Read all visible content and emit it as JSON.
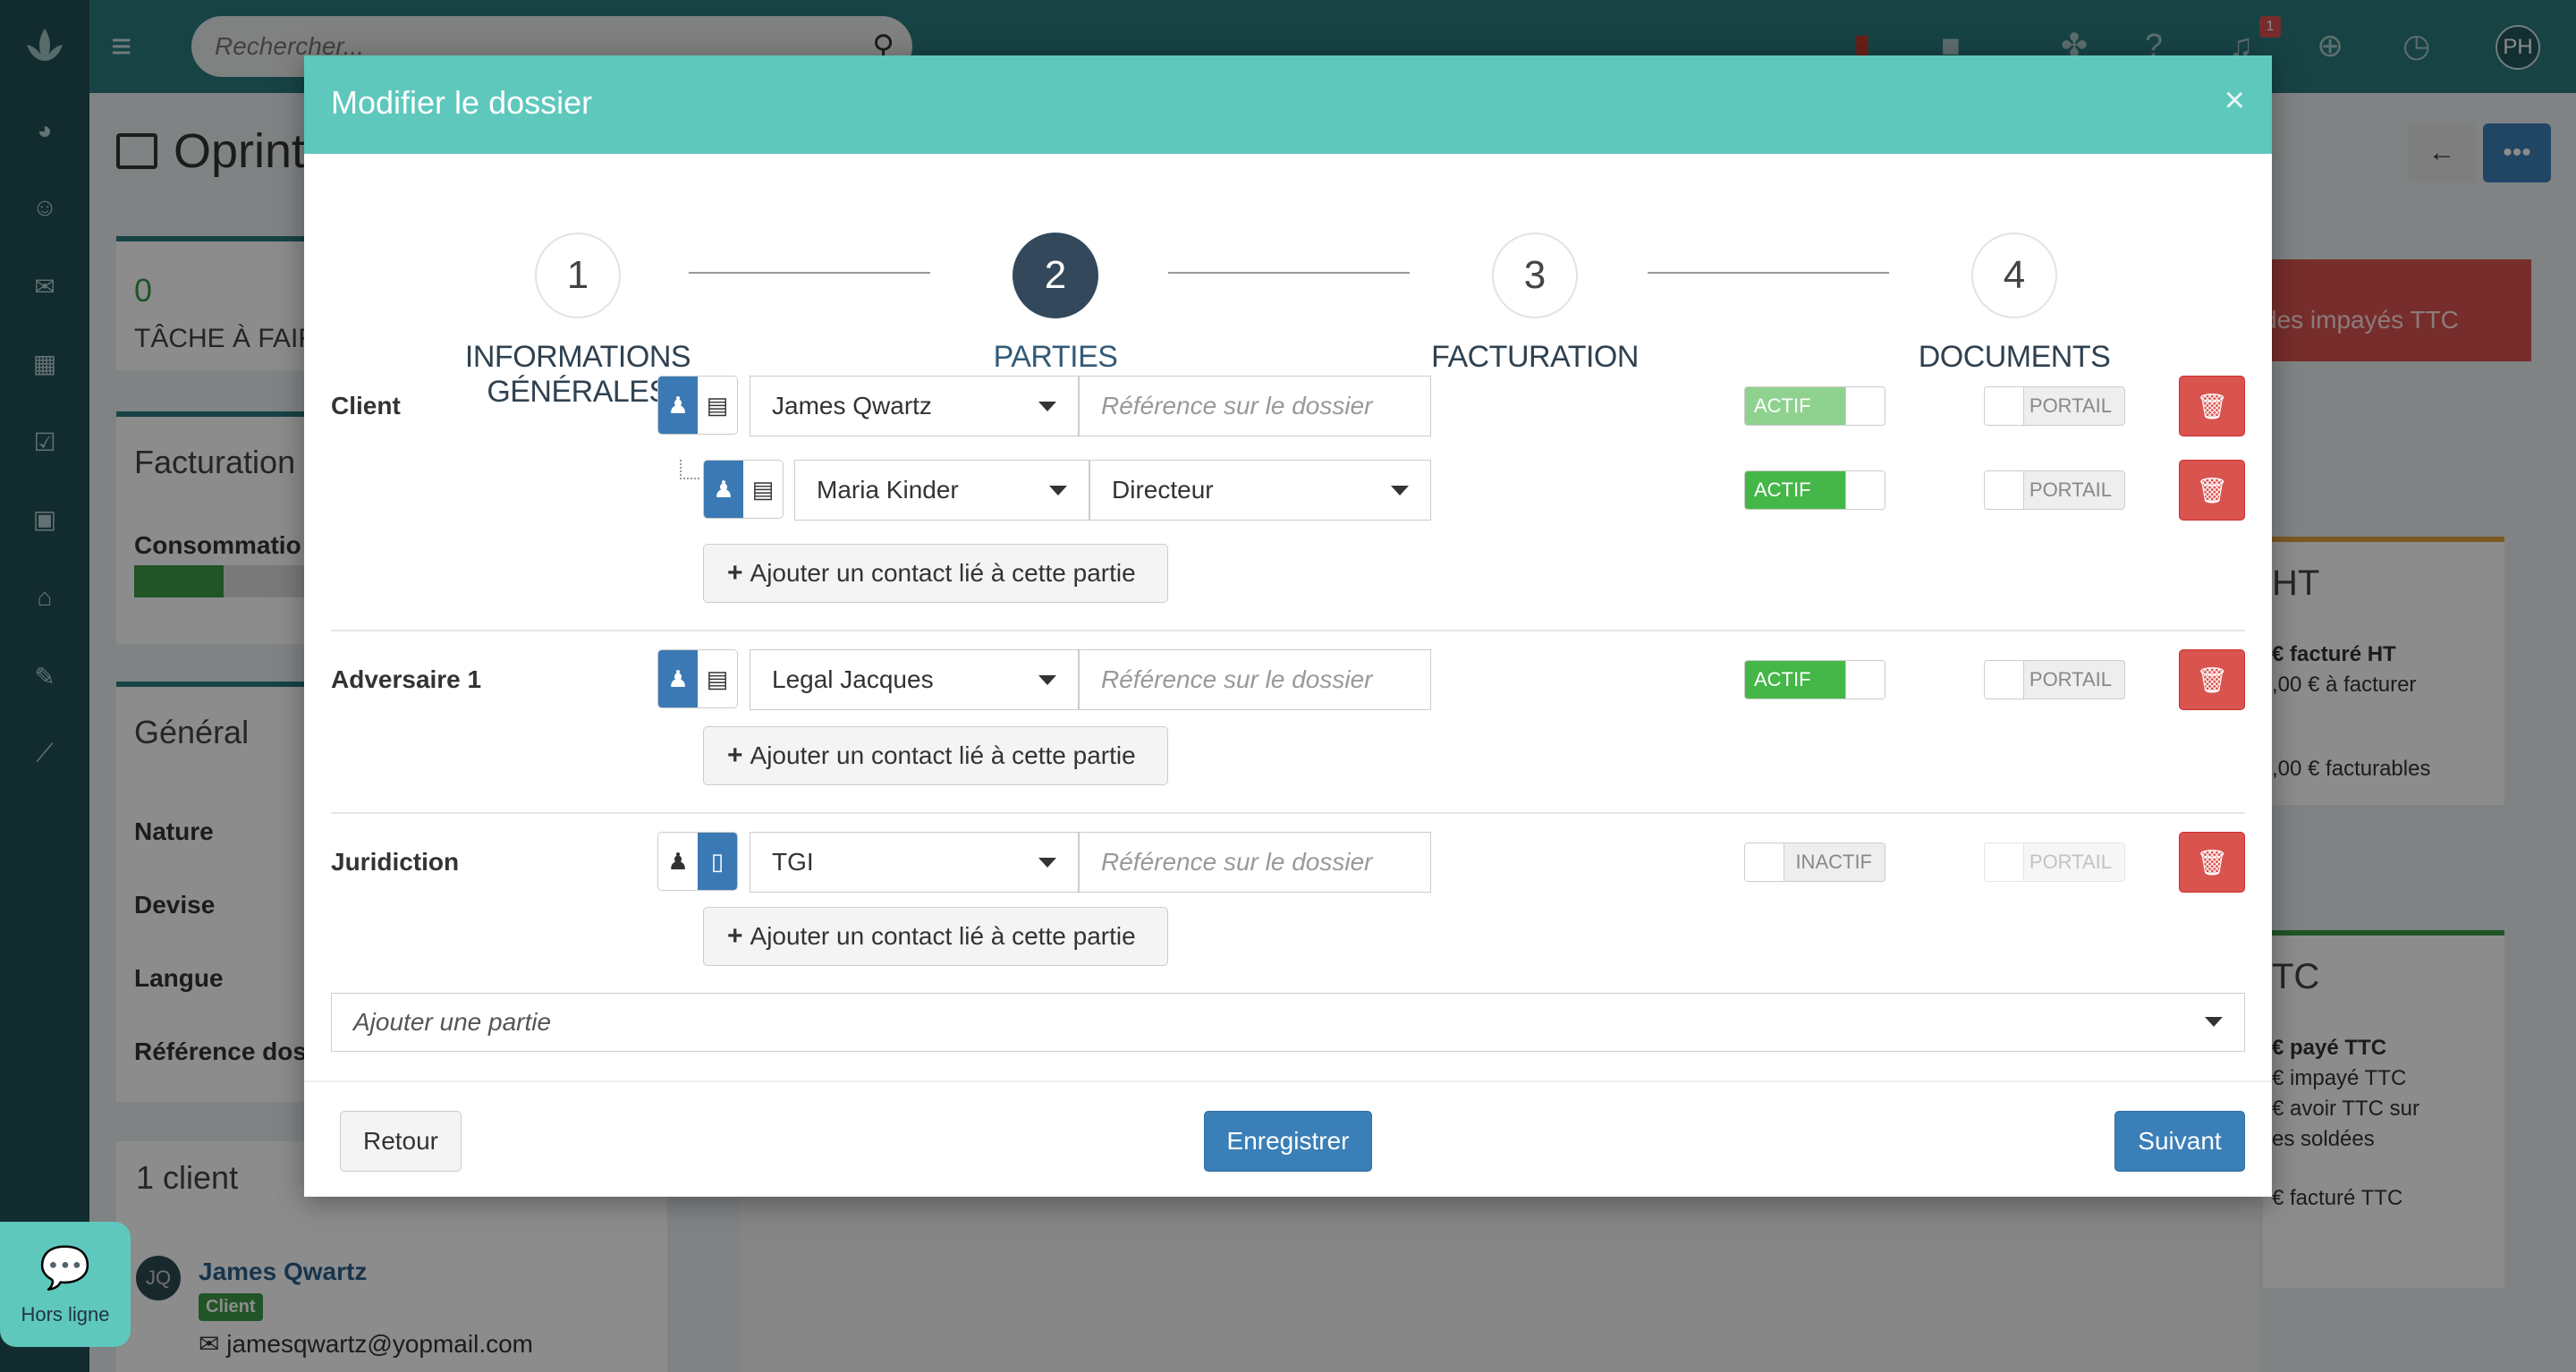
{
  "background": {
    "search_placeholder": "Rechercher...",
    "page_title": "Oprint",
    "notification_count": "1",
    "user_initials": "PH",
    "task_count": "0",
    "task_label": "TÂCHE À FAIR",
    "billing_title": "Facturation",
    "consumption_label": "Consommatio",
    "general_title": "Général",
    "general_fields": [
      "Nature",
      "Devise",
      "Langue",
      "Référence dos"
    ],
    "alert_text": "des impayés TTC",
    "ht_title": "HT",
    "ht_lines": [
      "€ facturé HT",
      ",00 € à facturer",
      ",00 € facturables"
    ],
    "ttc_title": "TC",
    "ttc_lines": [
      "€ payé TTC",
      "€ impayé TTC",
      "€ avoir TTC sur",
      "es soldées",
      "€ facturé TTC"
    ],
    "client_card_title": "1 client",
    "client_initials": "JQ",
    "client_name": "James Qwartz",
    "client_tag": "Client",
    "client_email": "jamesqwartz@yopmail.com",
    "chat_status": "Hors ligne"
  },
  "modal": {
    "title": "Modifier le dossier",
    "close": "×",
    "steps": [
      {
        "number": "1",
        "label": "INFORMATIONS GÉNÉRALES",
        "active": false
      },
      {
        "number": "2",
        "label": "PARTIES",
        "active": true
      },
      {
        "number": "3",
        "label": "FACTURATION",
        "active": false
      },
      {
        "number": "4",
        "label": "DOCUMENTS",
        "active": false
      }
    ],
    "parties": {
      "client": {
        "label": "Client",
        "name": "James Qwartz",
        "reference_placeholder": "Référence sur le dossier",
        "status": "ACTIF",
        "portal": "PORTAIL",
        "contact": {
          "name": "Maria Kinder",
          "role": "Directeur",
          "status": "ACTIF",
          "portal": "PORTAIL"
        }
      },
      "adversary": {
        "label": "Adversaire 1",
        "name": "Legal Jacques",
        "reference_placeholder": "Référence sur le dossier",
        "status": "ACTIF",
        "portal": "PORTAIL"
      },
      "jurisdiction": {
        "label": "Juridiction",
        "name": "TGI",
        "reference_placeholder": "Référence sur le dossier",
        "status": "INACTIF",
        "portal": "PORTAIL"
      }
    },
    "add_contact_label": "Ajouter un contact lié à cette partie",
    "add_party_placeholder": "Ajouter une partie",
    "footer": {
      "back": "Retour",
      "save": "Enregistrer",
      "next": "Suivant"
    }
  },
  "colors": {
    "header": "#5ec8bd",
    "active_step": "#33495b",
    "primary": "#3b7fb8",
    "danger": "#d9534f",
    "success": "#45b648"
  }
}
